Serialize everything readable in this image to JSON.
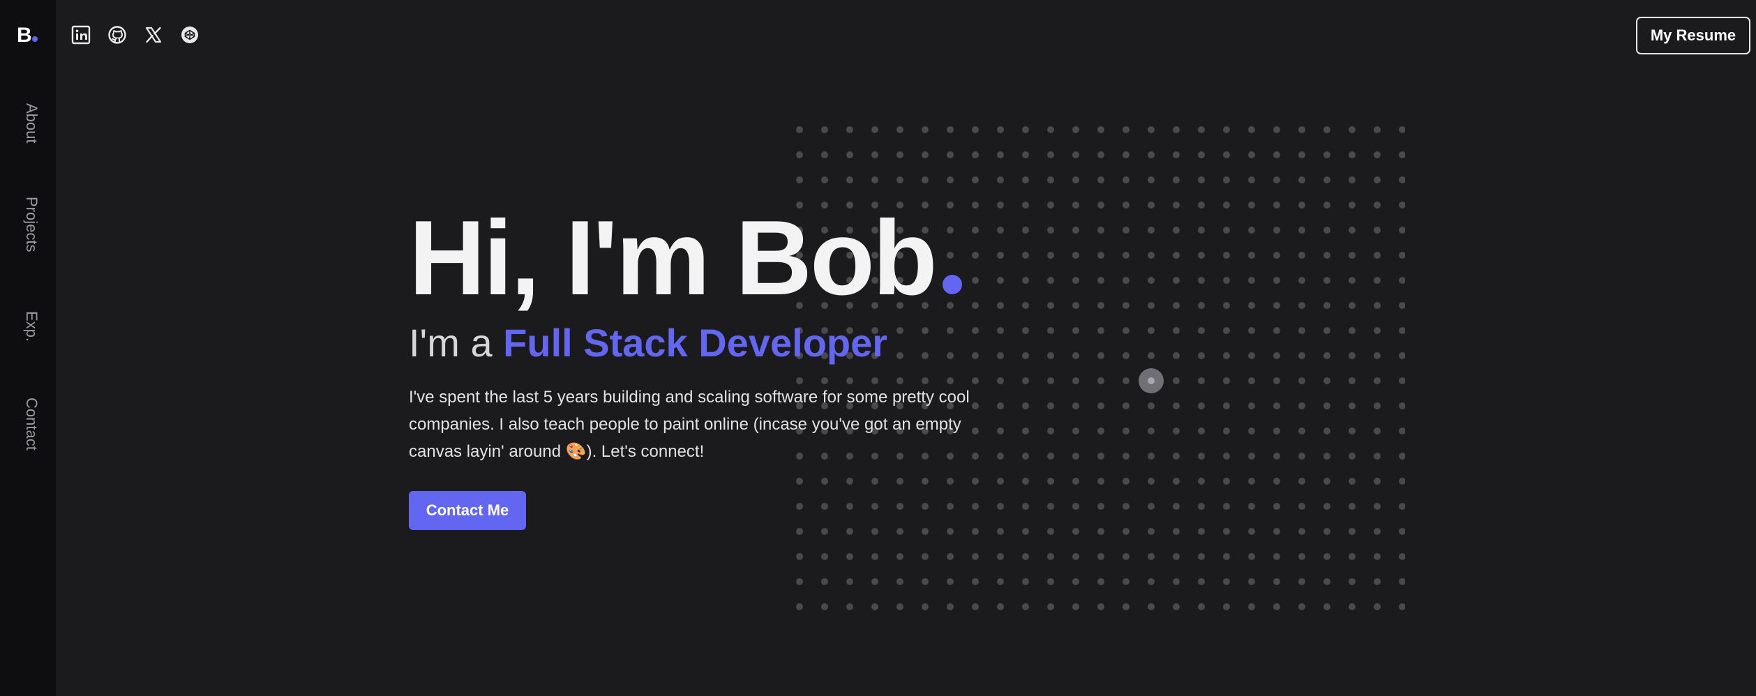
{
  "colors": {
    "accent": "#6366f1",
    "background": "#1b1b1d",
    "sidebar_bg": "#0e0e10",
    "dot": "#4a4a4d",
    "dot_highlight": "#707074"
  },
  "logo": {
    "text": "B"
  },
  "sidebar": {
    "items": [
      {
        "label": "About"
      },
      {
        "label": "Projects"
      },
      {
        "label": "Exp."
      },
      {
        "label": "Contact"
      }
    ]
  },
  "socials": [
    {
      "icon": "linkedin-icon"
    },
    {
      "icon": "github-icon"
    },
    {
      "icon": "x-icon"
    },
    {
      "icon": "codepen-icon"
    }
  ],
  "header": {
    "resume_label": "My Resume"
  },
  "hero": {
    "title": "Hi, I'm Bob",
    "subtitle_prefix": "I'm a ",
    "role": "Full Stack Developer",
    "description": "I've spent the last 5 years building and scaling software for some pretty cool companies. I also teach people to paint online (incase you've got an empty canvas layin' around 🎨). Let's connect!",
    "cta_label": "Contact Me"
  }
}
